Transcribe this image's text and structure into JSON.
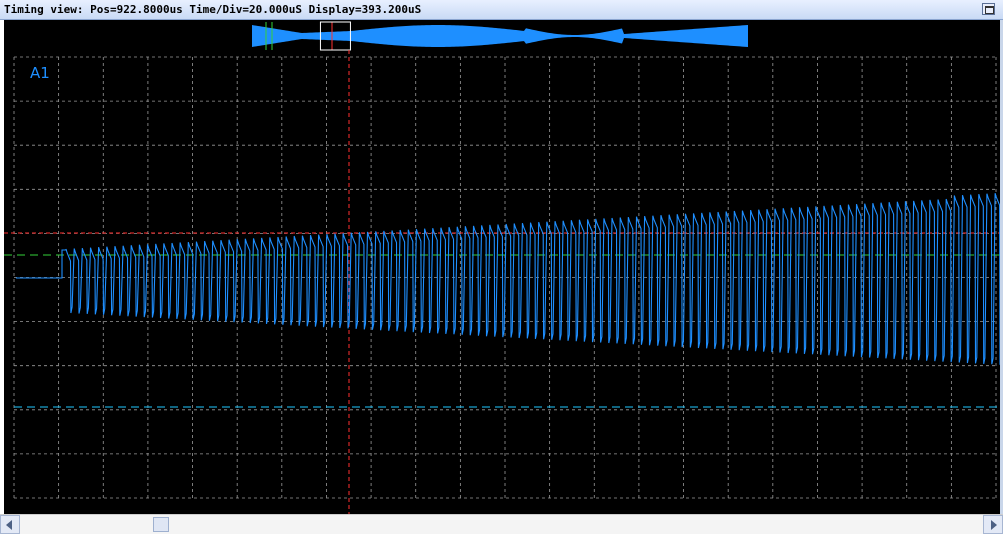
{
  "window": {
    "title": "Timing view: Pos=922.8000us Time/Div=20.000uS Display=393.200uS"
  },
  "channel": {
    "label": "A1"
  },
  "colors": {
    "background": "#000000",
    "grid": "#9a9a9a",
    "signal": "#1e8fff",
    "cursor_red": "#ff3030",
    "trigger_green": "#35d23a",
    "baseline_cyan": "#1ec8ff"
  },
  "overview": {
    "viewport_position": 0.14
  },
  "scrollbar": {
    "thumb_position": 0.14
  }
}
